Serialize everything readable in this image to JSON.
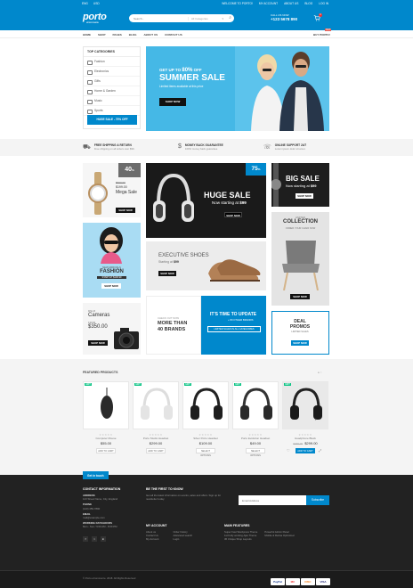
{
  "topbar": {
    "lang": "ENG",
    "currency": "USD",
    "links": [
      "WELCOME TO PORTO!",
      "MY ACCOUNT",
      "ABOUT US",
      "BLOG",
      "LOG IN"
    ]
  },
  "header": {
    "logo": "porto",
    "logo_sub": "eCommerce",
    "search_placeholder": "Search...",
    "search_category": "All Categories",
    "phone_label": "CALL US NOW",
    "phone": "+123 5678 890",
    "cart_count": "0"
  },
  "nav": {
    "items": [
      "HOME",
      "SHOP",
      "PAGES",
      "BLOG",
      "ABOUT US",
      "CONTACT US"
    ],
    "buy": "BUY PORTO!",
    "hot": "HOT"
  },
  "categories": {
    "title": "TOP CATEGORIES",
    "items": [
      "Fashion",
      "Electronics",
      "Gifts",
      "Home & Garden",
      "Music",
      "Sports"
    ],
    "button": "HUGE SALE - 70% OFF"
  },
  "hero": {
    "pre": "GET UP TO",
    "pre_pct": "80%",
    "pre_post": "OFF",
    "title": "SUMMER SALE",
    "sub": "Limited items available at this price",
    "button": "SHOP NOW"
  },
  "features": [
    {
      "icon": "truck-icon",
      "title": "FREE SHIPPING & RETURN",
      "text": "Free shipping on all orders over $99."
    },
    {
      "icon": "money-icon",
      "title": "MONEY BACK GUARANTEE",
      "text": "100% money back guarantee"
    },
    {
      "icon": "support-icon",
      "title": "ONLINE SUPPORT 24/7",
      "text": "Lorem ipsum dolor sit amet."
    }
  ],
  "tiles": {
    "mega": {
      "badge": "40",
      "badge_unit": "%",
      "old": "$500.00",
      "price": "$199.00",
      "label": "Mega Sale",
      "btn": "SHOP NOW"
    },
    "huge": {
      "badge": "75",
      "badge_unit": "%",
      "title": "HUGE SALE",
      "sub": "Now starting at",
      "price": "$99",
      "btn": "SHOP NOW"
    },
    "big": {
      "title": "BIG SALE",
      "sub": "Now starting at",
      "price": "$99",
      "btn": "SHOP NOW"
    },
    "fashion": {
      "pre": "NEW ARRIVALS",
      "title": "FASHION",
      "sub": "START AT $100.99",
      "btn": "SHOP NOW"
    },
    "shoes": {
      "title": "EXECUTIVE SHOES",
      "sub": "Starting at",
      "price": "$99",
      "btn": "SHOP NOW"
    },
    "collection": {
      "pre": "LIMITED",
      "title": "COLLECTION",
      "sub": "ORDER YOUR CHAIR NOW",
      "btn": "SHOP NOW"
    },
    "cameras": {
      "pre": "DSLR",
      "title": "Cameras",
      "sub": "FROM",
      "price": "$350.00",
      "btn": "SHOP NOW"
    },
    "brands": {
      "pre": "CHECK OUT NOW",
      "title1": "MORE THAN",
      "title2": "40 BRANDS",
      "right_title": "IT'S TIME TO UPDATE",
      "right_sub": "+ 80 OTHER BRANDS",
      "right_btn": "LIMITED SALES IN ALL CATEGORIES"
    },
    "deal": {
      "title": "DEAL",
      "title2": "PROMOS",
      "sub": "LIMITED SALES",
      "btn": "SHOP NOW"
    }
  },
  "featured": {
    "title": "FEATURED PRODUCTS",
    "products": [
      {
        "badge": "HOT",
        "name": "Computer Mouse",
        "price": "$55.00",
        "old": "",
        "add": "ADD TO CART"
      },
      {
        "badge": "HOT",
        "name": "Porto Studio Headset",
        "price": "$299.00",
        "old": "",
        "add": "ADD TO CART"
      },
      {
        "badge": "HOT",
        "name": "Silver Porto Headset",
        "price": "$109.00",
        "old": "",
        "add": "SELECT OPTIONS"
      },
      {
        "badge": "HOT",
        "name": "Porto Evolution Headset",
        "price": "$49.00",
        "old": "",
        "add": "SELECT OPTIONS"
      },
      {
        "badge": "HOT",
        "name": "Headphone Black",
        "price": "$299.00",
        "old": "$299.00",
        "add": "ADD TO CART"
      }
    ]
  },
  "footer": {
    "ribbon": "Get in touch",
    "contact_title": "CONTACT INFORMATION",
    "address_label": "ADDRESS",
    "address": "123 Street Name, City, England",
    "phone_label": "PHONE",
    "phone": "(123) 456-7890",
    "email_label": "EMAIL",
    "email": "mail@example.com",
    "days_label": "WORKING DAYS/HOURS",
    "days": "Mon - Sun / 9:00 AM - 8:00 PM",
    "news_title": "BE THE FIRST TO KNOW",
    "news_text": "Get all the latest information on events, sales and offers. Sign up for newsletter today.",
    "news_placeholder": "Email Address",
    "news_btn": "Subscribe",
    "account_title": "MY ACCOUNT",
    "account_col1": [
      "About us",
      "Contact Us",
      "My Account"
    ],
    "account_col2": [
      "Order history",
      "Advanced search",
      "Login"
    ],
    "main_title": "MAIN FEATURES",
    "main_col1": [
      "Super Fast Wordpress Theme",
      "1st Fully working Ajax Theme",
      "36 Unique Shop Layouts"
    ],
    "main_col2": [
      "Powerful Admin Panel",
      "Mobile & Retina Optimized"
    ],
    "copyright": "© Porto eCommerce. 2018. All Rights Reserved",
    "payments": [
      "PayPal",
      "MC",
      "DISC",
      "VISA"
    ]
  }
}
